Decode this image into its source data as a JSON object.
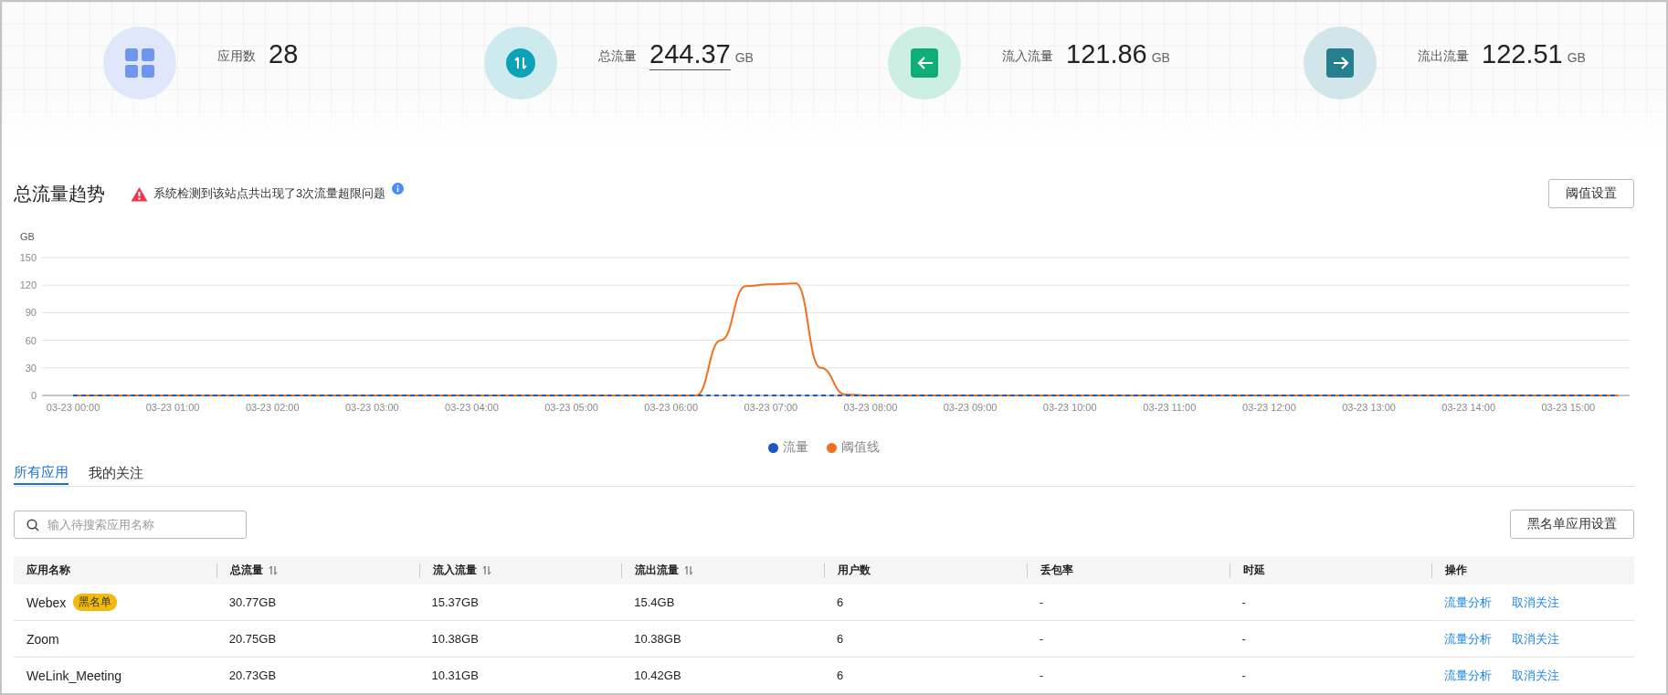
{
  "stats": [
    {
      "kind": "apps",
      "label": "应用数",
      "value": "28",
      "linked": false
    },
    {
      "kind": "total",
      "label": "总流量",
      "value": "244.37",
      "unit": "GB",
      "linked": true
    },
    {
      "kind": "inbound",
      "label": "流入流量",
      "value": "121.86",
      "unit": "GB",
      "linked": false
    },
    {
      "kind": "outbound",
      "label": "流出流量",
      "value": "122.51",
      "unit": "GB",
      "linked": false
    }
  ],
  "trend": {
    "title": "总流量趋势",
    "alert": "系统检测到该站点共出现了3次流量超限问题",
    "button": "阈值设置",
    "chart_data": {
      "type": "line",
      "grid": true,
      "ylabel": "GB",
      "ylim": [
        0,
        150
      ],
      "yticks": [
        0,
        30,
        60,
        90,
        120,
        150
      ],
      "categories": [
        "03-23 00:00",
        null,
        null,
        null,
        "03-23 01:00",
        null,
        null,
        null,
        "03-23 02:00",
        null,
        null,
        null,
        "03-23 03:00",
        null,
        null,
        null,
        "03-23 04:00",
        null,
        null,
        null,
        "03-23 05:00",
        null,
        null,
        null,
        "03-23 06:00",
        null,
        null,
        null,
        "03-23 07:00",
        null,
        null,
        null,
        "03-23 08:00",
        null,
        null,
        null,
        "03-23 09:00",
        null,
        null,
        null,
        "03-23 10:00",
        null,
        null,
        null,
        "03-23 11:00",
        null,
        null,
        null,
        "03-23 12:00",
        null,
        null,
        null,
        "03-23 13:00",
        null,
        null,
        null,
        "03-23 14:00",
        null,
        null,
        null,
        "03-23 15:00",
        null,
        null
      ],
      "series": [
        {
          "name": "流量",
          "color": "#1f55c7",
          "line_style": "dashed",
          "values": [
            0,
            0,
            0,
            0,
            0,
            0,
            0,
            0,
            0,
            0,
            0,
            0,
            0,
            0,
            0,
            0,
            0,
            0,
            0,
            0,
            0,
            0,
            0,
            0,
            0,
            0,
            0,
            0,
            0,
            0,
            0,
            0,
            0,
            0,
            0,
            0,
            0,
            0,
            0,
            0,
            0,
            0,
            0,
            0,
            0,
            0,
            0,
            0,
            0,
            0,
            0,
            0,
            0,
            0,
            0,
            0,
            0,
            0,
            0,
            0,
            0,
            0,
            0
          ]
        },
        {
          "name": "阈值线",
          "color": "#f07020",
          "line_style": "solid",
          "values": [
            0,
            0,
            0,
            0,
            0,
            0,
            0,
            0,
            0,
            0,
            0,
            0,
            0,
            0,
            0,
            0,
            0,
            0,
            0,
            0,
            0,
            0,
            0,
            0,
            0,
            0,
            60,
            119,
            121,
            122,
            30,
            1,
            0,
            0,
            0,
            0,
            0,
            0,
            0,
            0,
            0,
            0,
            0,
            0,
            0,
            0,
            0,
            0,
            0,
            0,
            0,
            0,
            0,
            0,
            0,
            0,
            0,
            0,
            0,
            0,
            0,
            0,
            0
          ]
        }
      ]
    }
  },
  "tabs": [
    {
      "label": "所有应用",
      "selected": true
    },
    {
      "label": "我的关注",
      "selected": false
    }
  ],
  "search": {
    "placeholder": "输入待搜索应用名称"
  },
  "blacklist_button": "黑名单应用设置",
  "table": {
    "columns": [
      {
        "label": "应用名称",
        "kind": "plain"
      },
      {
        "label": "总流量",
        "kind": "sortable"
      },
      {
        "label": "流入流量",
        "kind": "sortable"
      },
      {
        "label": "流出流量",
        "kind": "sortable"
      },
      {
        "label": "用户数",
        "kind": "plain"
      },
      {
        "label": "丢包率",
        "kind": "plain"
      },
      {
        "label": "时延",
        "kind": "plain"
      },
      {
        "label": "操作",
        "kind": "plain"
      }
    ],
    "rows": [
      {
        "tag": "黑名单",
        "cells": [
          "Webex",
          "30.77GB",
          "15.37GB",
          "15.4GB",
          "6",
          "-",
          "-"
        ],
        "actions": [
          "流量分析",
          "取消关注"
        ]
      },
      {
        "cells": [
          "Zoom",
          "20.75GB",
          "10.38GB",
          "10.38GB",
          "6",
          "-",
          "-"
        ],
        "actions": [
          "流量分析",
          "取消关注"
        ]
      },
      {
        "cells": [
          "WeLink_Meeting",
          "20.73GB",
          "10.31GB",
          "10.42GB",
          "6",
          "-",
          "-"
        ],
        "actions": [
          "流量分析",
          "取消关注"
        ]
      }
    ]
  }
}
